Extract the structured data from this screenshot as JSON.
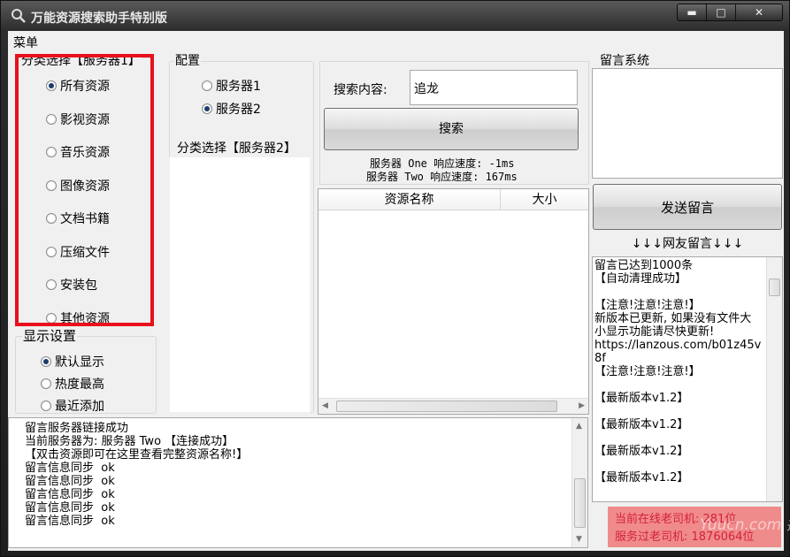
{
  "window": {
    "title": "万能资源搜索助手特别版",
    "min_label": "▬",
    "max_label": "□",
    "close_label": "✕"
  },
  "menu": {
    "label": "菜单"
  },
  "category": {
    "legend": "分类选择【服务器1】",
    "options": [
      {
        "label": "所有资源",
        "selected": true
      },
      {
        "label": "影视资源",
        "selected": false
      },
      {
        "label": "音乐资源",
        "selected": false
      },
      {
        "label": "图像资源",
        "selected": false
      },
      {
        "label": "文档书籍",
        "selected": false
      },
      {
        "label": "压缩文件",
        "selected": false
      },
      {
        "label": "安装包",
        "selected": false
      },
      {
        "label": "其他资源",
        "selected": false
      }
    ]
  },
  "display": {
    "legend": "显示设置",
    "options": [
      {
        "label": "默认显示",
        "selected": true
      },
      {
        "label": "热度最高",
        "selected": false
      },
      {
        "label": "最近添加",
        "selected": false
      }
    ]
  },
  "config": {
    "legend": "配置",
    "servers": [
      {
        "label": "服务器1",
        "selected": false
      },
      {
        "label": "服务器2",
        "selected": true
      }
    ],
    "category2_legend": "分类选择【服务器2】"
  },
  "search": {
    "label": "搜索内容:",
    "value": "追龙",
    "button": "搜索",
    "speed_one": "服务器 One 响应速度: -1ms",
    "speed_two": "服务器 Two 响应速度: 167ms"
  },
  "results": {
    "columns": [
      "资源名称",
      "大小"
    ]
  },
  "log": {
    "lines": [
      "留言服务器链接成功",
      "当前服务器为: 服务器 Two 【连接成功】",
      "【双击资源即可在这里查看完整资源名称!】",
      "留言信息同步  ok",
      "留言信息同步  ok",
      "留言信息同步  ok",
      "留言信息同步  ok",
      "留言信息同步  ok"
    ]
  },
  "message": {
    "legend": "留言系统",
    "send_button": "发送留言",
    "friends_header": "↓↓↓网友留言↓↓↓",
    "lines": [
      "留言已达到1000条",
      "【自动清理成功】",
      "",
      "【注意!注意!注意!】",
      "新版本已更新, 如果没有文件大小显示功能请尽快更新!",
      "https://lanzous.com/b01z45v8f",
      "【注意!注意!注意!】",
      "",
      "【最新版本v1.2】",
      "",
      "【最新版本v1.2】",
      "",
      "【最新版本v1.2】",
      "",
      "【最新版本v1.2】"
    ]
  },
  "stats": {
    "online": "当前在线老司机: 281位",
    "served": "服务过老司机: 1876064位"
  },
  "watermark": "Yuucn.com 插件"
}
